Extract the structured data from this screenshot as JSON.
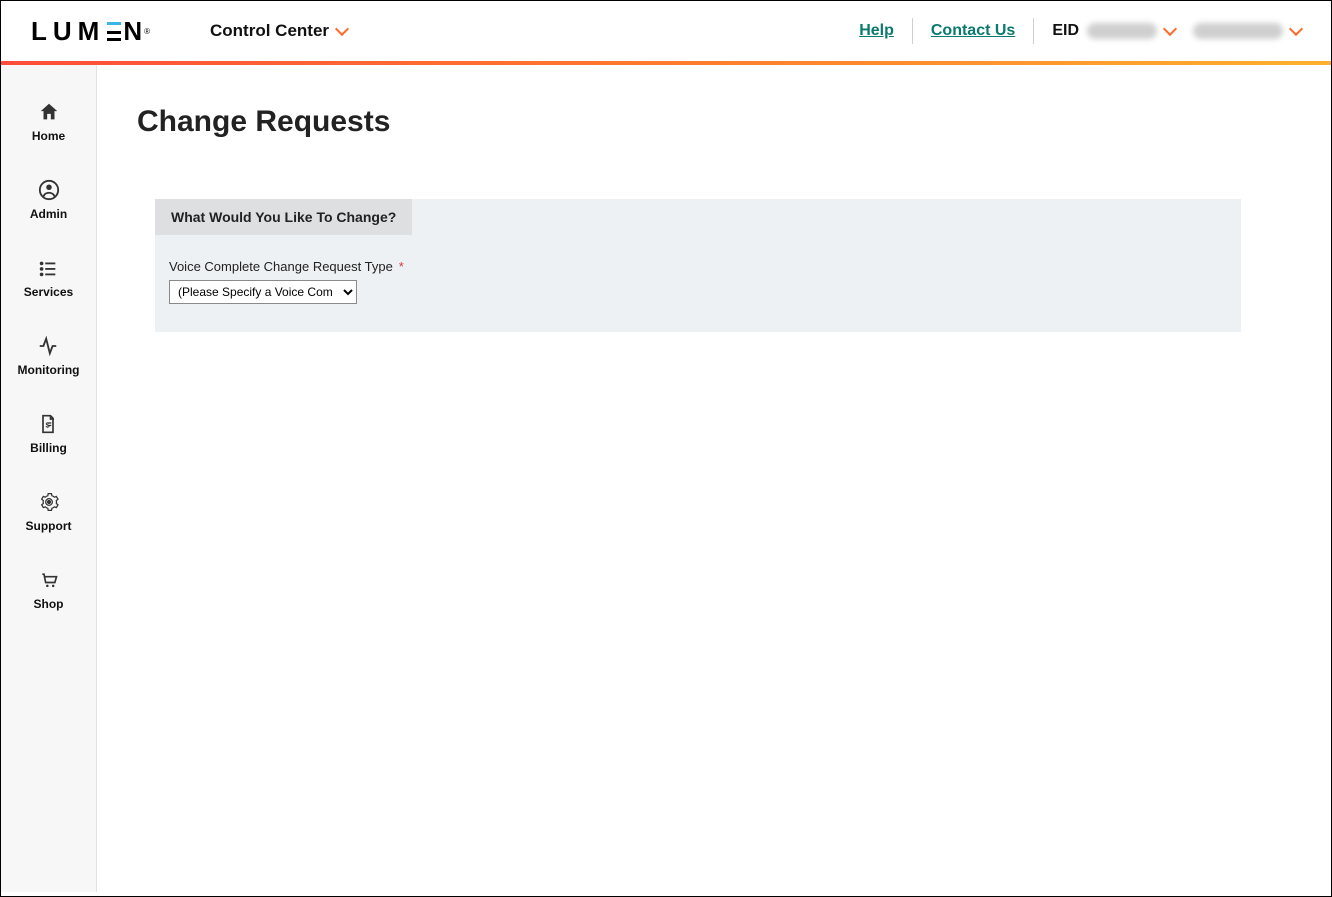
{
  "header": {
    "logo_text": "LUMEN",
    "app_name": "Control Center",
    "help_label": "Help",
    "contact_label": "Contact Us",
    "eid_label": "EID"
  },
  "sidebar": {
    "items": [
      {
        "label": "Home",
        "icon": "home"
      },
      {
        "label": "Admin",
        "icon": "user"
      },
      {
        "label": "Services",
        "icon": "list"
      },
      {
        "label": "Monitoring",
        "icon": "activity"
      },
      {
        "label": "Billing",
        "icon": "invoice"
      },
      {
        "label": "Support",
        "icon": "gear"
      },
      {
        "label": "Shop",
        "icon": "cart"
      }
    ]
  },
  "page": {
    "title": "Change Requests",
    "tab_label": "What Would You Like To Change?",
    "field_label": "Voice Complete Change Request Type",
    "select_placeholder": "(Please Specify a Voice Com"
  }
}
